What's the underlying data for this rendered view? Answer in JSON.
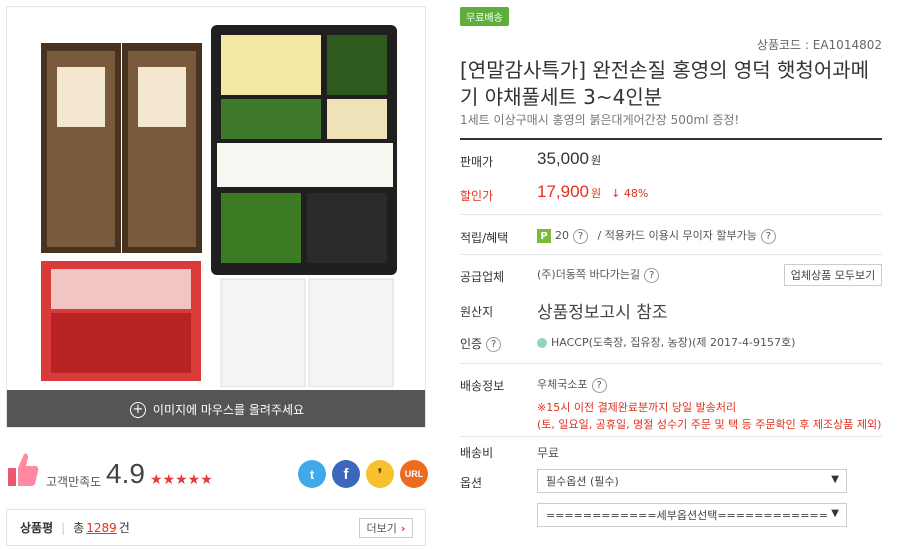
{
  "image_panel": {
    "hover_text": "이미지에 마우스를 올려주세요"
  },
  "rating": {
    "label": "고객만족도",
    "value": "4.9",
    "stars": "★★★★★"
  },
  "share": {
    "url_label": "URL"
  },
  "review": {
    "label": "상품평",
    "total_prefix": "총",
    "count": "1289",
    "suffix": "건",
    "more_label": "더보기"
  },
  "product": {
    "badge": "무료배송",
    "code": "상품코드 : EA1014802",
    "title": "[연말감사특가] 완전손질 홍영의 영덕 햇청어과메기 야채풀세트 3~4인분",
    "subtitle": "1세트 이상구매시 홍영의 붉은대게어간장 500ml 증정!"
  },
  "fields": {
    "price_label": "판매가",
    "price": "35,000",
    "unit": "원",
    "sale_label": "할인가",
    "sale_price": "17,900",
    "discount": "↓ 48%",
    "points_label": "적립/혜택",
    "points_badge": "P",
    "points_value": "20",
    "card_text": "/  적용카드 이용시 무이자 할부가능",
    "vendor_label": "공급업체",
    "vendor": "(주)더동쪽 바다가는길",
    "vendor_btn": "업체상품 모두보기",
    "origin_label": "원산지",
    "origin": "상품정보고시 참조",
    "cert_label": "인증",
    "cert": "HACCP(도축장, 집유장, 농장)(제 2017-4-9157호)",
    "ship_label": "배송정보",
    "ship": "우체국소포",
    "ship_note1": "※15시 이전 결제완료분까지 당일 발송처리",
    "ship_note2": "(토, 일요일, 공휴일, 명절 성수기 주문 및 택 등 주문확인 후 제조상품 제외)",
    "fee_label": "배송비",
    "fee": "무료",
    "option_label": "옵션",
    "option1": "필수옵션 (필수)",
    "option2": "============세부옵션선택============"
  }
}
